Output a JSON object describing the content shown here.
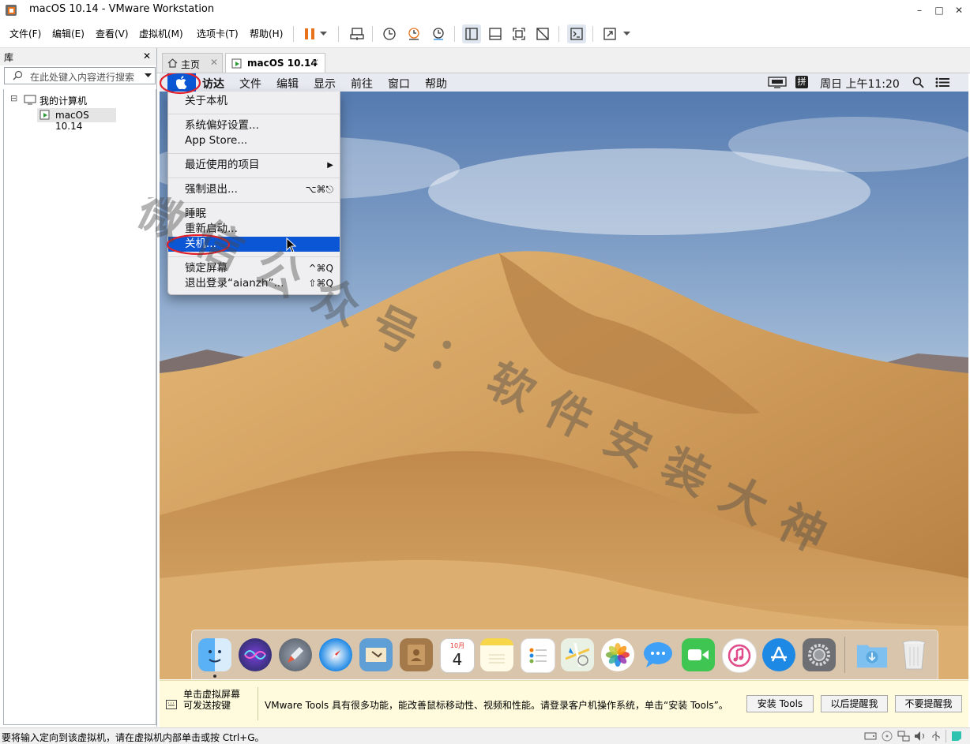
{
  "window": {
    "title": "macOS 10.14 - VMware Workstation",
    "controls": {
      "minimize": "–",
      "maximize": "□",
      "close": "✕"
    }
  },
  "menubar": {
    "items": [
      "文件(F)",
      "编辑(E)",
      "查看(V)",
      "虚拟机(M)",
      "选项卡(T)",
      "帮助(H)"
    ]
  },
  "toolbar": {
    "icons": [
      "pause-icon",
      "dropdown-icon",
      "send-ctrl-alt-del-icon",
      "snapshot-icon",
      "revert-snapshot-icon",
      "snapshot-manager-icon",
      "show-library-icon",
      "thumbnail-icon",
      "fullscreen-icon",
      "unity-icon",
      "console-icon",
      "stretch-icon"
    ],
    "accent": "#e8711c"
  },
  "library": {
    "title": "库",
    "close": "✕",
    "search_placeholder": "在此处键入内容进行搜索",
    "tree_root_toggle": "⊟",
    "tree_root": "我的计算机",
    "tree_child": "macOS 10.14"
  },
  "tabs": [
    {
      "label": "主页",
      "close": "✕"
    },
    {
      "label": "macOS 10.14",
      "close": "✕"
    }
  ],
  "mac": {
    "menubar": [
      "访达",
      "文件",
      "编辑",
      "显示",
      "前往",
      "窗口",
      "帮助"
    ],
    "input_method": "拼",
    "clock": "周日 上午11:20",
    "apple_menu": {
      "about": "关于本机",
      "prefs": "系统偏好设置...",
      "appstore": "App Store...",
      "recent": "最近使用的项目",
      "recent_arrow": "▶",
      "force_quit": "强制退出...",
      "force_quit_sc": "⌥⌘⎋",
      "sleep": "睡眠",
      "restart": "重新启动...",
      "shutdown": "关机...",
      "lock": "锁定屏幕",
      "lock_sc": "^⌘Q",
      "logout": "退出登录“aianzh”...",
      "logout_sc": "⇧⌘Q"
    },
    "dock": {
      "icons": [
        "finder-icon",
        "siri-icon",
        "launchpad-icon",
        "safari-icon",
        "mail-icon",
        "contacts-icon",
        "calendar-icon",
        "notes-icon",
        "reminders-icon",
        "maps-icon",
        "photos-icon",
        "messages-icon",
        "facetime-icon",
        "itunes-icon",
        "app-store-icon",
        "system-preferences-icon",
        "downloads-icon",
        "trash-icon"
      ],
      "calendar_month": "10月",
      "calendar_day": "4"
    },
    "highlight_color": "#0b56d4"
  },
  "watermark": {
    "text": "微信公众号：软件安装大神"
  },
  "tools_bar": {
    "hint_line1": "单击虚拟屏幕",
    "hint_line2": "可发送按键",
    "message": "VMware Tools 具有很多功能，能改善鼠标移动性、视频和性能。请登录客户机操作系统，单击“安装 Tools”。",
    "install": "安装 Tools",
    "remind_later": "以后提醒我",
    "never": "不要提醒我"
  },
  "status": {
    "text": "要将输入定向到该虚拟机，请在虚拟机内部单击或按 Ctrl+G。"
  }
}
